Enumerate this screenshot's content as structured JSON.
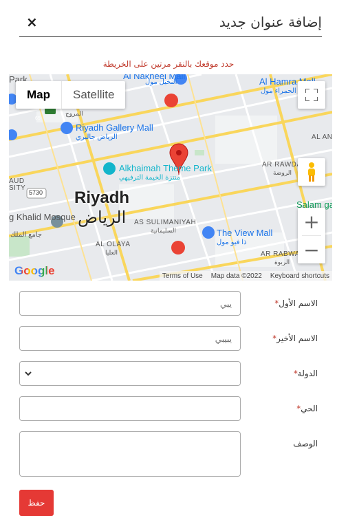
{
  "header": {
    "title": "إضافة عنوان جديد",
    "close_label": "×"
  },
  "map_hint": "حدد موقعك بالنقر مرتين على الخريطة",
  "map": {
    "type_buttons": [
      "Map",
      "Satellite"
    ],
    "labels": {
      "city": "Riyadh",
      "city_ar": "الرياض",
      "poi_gallery": "Riyadh Gallery Mall",
      "poi_gallery_ar": "الرياض جاليري",
      "poi_park": "Alkhaimah Theme Park",
      "poi_park_ar": "منتزة الخيمة الترفيهي",
      "poi_viewmall": "The View Mall",
      "poi_viewmall_ar": "ذا فيو مول",
      "poi_nakheel": "Al Nakheel Mall",
      "poi_nakheel_ar": "النخيل مول",
      "poi_hamra": "Al Hamra Mall",
      "poi_hamra_ar": "الحمراء مول",
      "poi_salam": "Salam ga",
      "poi_mosque": "g Khalid Mosque",
      "poi_mosque_ar": "جامع الملك",
      "dist_rawda": "AR RAWDA",
      "dist_rawda_ar": "الروضة",
      "dist_suli": "AS SULIMANIYAH",
      "dist_suli_ar": "السليمانية",
      "dist_olaya": "AL OLAYA",
      "dist_olaya_ar": "العليا",
      "dist_rabwah": "AR RABWAH",
      "dist_rabwah_ar": "الربوة",
      "dist_an": "AL AN",
      "dist_aud": "AUD",
      "dist_sity": "SITY",
      "dist_park": "Park",
      "road_5730": "5730",
      "road_65": "65",
      "road_ar": "المروج"
    },
    "google_logo": "Google",
    "footer": {
      "terms": "Terms of Use",
      "data": "Map data ©2022",
      "shortcuts": "Keyboard shortcuts"
    }
  },
  "form": {
    "first_name": {
      "label": "الاسم الأول",
      "required": "*",
      "value": "يبي"
    },
    "last_name": {
      "label": "الاسم الأخير",
      "required": "*",
      "value": "يبيبي"
    },
    "country": {
      "label": "الدولة",
      "required": "*",
      "value": ""
    },
    "district": {
      "label": "الحي",
      "required": "*",
      "value": ""
    },
    "description": {
      "label": "الوصف",
      "value": ""
    },
    "save_label": "حفظ"
  },
  "colors": {
    "accent": "#e53935",
    "hint": "#c0392b",
    "pin": "#ea4335"
  }
}
